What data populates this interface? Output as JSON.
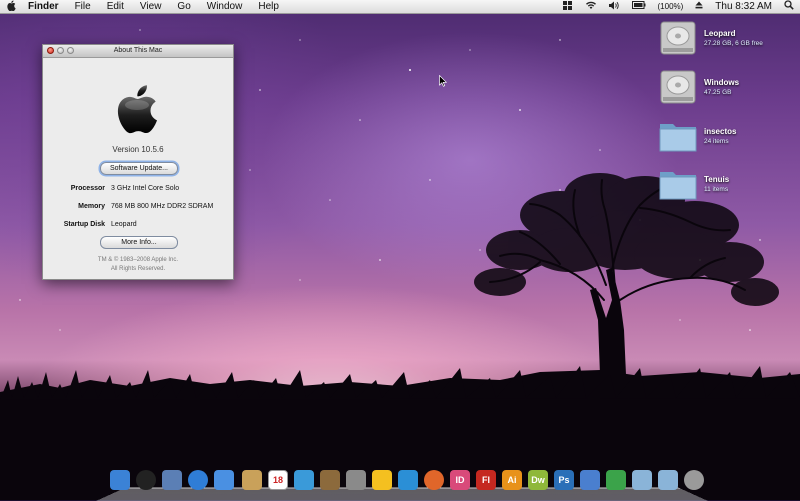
{
  "menubar": {
    "apple": "",
    "app": "Finder",
    "items": [
      "File",
      "Edit",
      "View",
      "Go",
      "Window",
      "Help"
    ],
    "battery": "(100%)",
    "clock": "Thu 8:32 AM"
  },
  "about_window": {
    "title": "About This Mac",
    "version": "Version 10.5.6",
    "software_update_label": "Software Update...",
    "processor_label": "Processor",
    "processor_value": "3 GHz Intel Core Solo",
    "memory_label": "Memory",
    "memory_value": "768 MB 800 MHz DDR2 SDRAM",
    "startup_label": "Startup Disk",
    "startup_value": "Leopard",
    "more_info_label": "More Info...",
    "copyright_1": "TM & © 1983–2008 Apple Inc.",
    "copyright_2": "All Rights Reserved."
  },
  "desktop_icons": [
    {
      "name": "Leopard",
      "sub": "27.28 GB, 6 GB free",
      "icon": "hard-drive-icon"
    },
    {
      "name": "Windows",
      "sub": "47.25 GB",
      "icon": "hard-drive-icon"
    },
    {
      "name": "insectos",
      "sub": "24 items",
      "icon": "folder-icon"
    },
    {
      "name": "Tenuis",
      "sub": "11 items",
      "icon": "folder-icon"
    }
  ],
  "dock": {
    "items": [
      {
        "name": "finder",
        "label": "",
        "color": "#3b82d6"
      },
      {
        "name": "dashboard",
        "label": "",
        "color": "#222222"
      },
      {
        "name": "mail",
        "label": "",
        "color": "#5b7fb5"
      },
      {
        "name": "safari",
        "label": "",
        "color": "#2f7dd6"
      },
      {
        "name": "ichat",
        "label": "",
        "color": "#4a90e2"
      },
      {
        "name": "address-book",
        "label": "",
        "color": "#c9a15a"
      },
      {
        "name": "ical",
        "label": "18",
        "color": "#ffffff"
      },
      {
        "name": "itunes",
        "label": "",
        "color": "#3a9ad9"
      },
      {
        "name": "preview",
        "label": "",
        "color": "#8c6a3c"
      },
      {
        "name": "system-preferences",
        "label": "",
        "color": "#8a8a8a"
      },
      {
        "name": "adium",
        "label": "",
        "color": "#f4c020"
      },
      {
        "name": "twitterrific",
        "label": "",
        "color": "#2b8fd6"
      },
      {
        "name": "firefox",
        "label": "",
        "color": "#e0662a"
      },
      {
        "name": "indesign",
        "label": "ID",
        "color": "#d94a7a"
      },
      {
        "name": "flash",
        "label": "Fl",
        "color": "#c52820"
      },
      {
        "name": "illustrator",
        "label": "Ai",
        "color": "#e8921a"
      },
      {
        "name": "dreamweaver",
        "label": "Dw",
        "color": "#8fb83a"
      },
      {
        "name": "photoshop",
        "label": "Ps",
        "color": "#2a6fb8"
      },
      {
        "name": "ms-word",
        "label": "",
        "color": "#4a7fcf"
      },
      {
        "name": "messenger",
        "label": "",
        "color": "#3ba34a"
      },
      {
        "name": "applications-folder",
        "label": "",
        "color": "#8ab4d8"
      },
      {
        "name": "documents-folder",
        "label": "",
        "color": "#8ab4d8"
      },
      {
        "name": "trash",
        "label": "",
        "color": "#9a9a9a"
      }
    ]
  }
}
